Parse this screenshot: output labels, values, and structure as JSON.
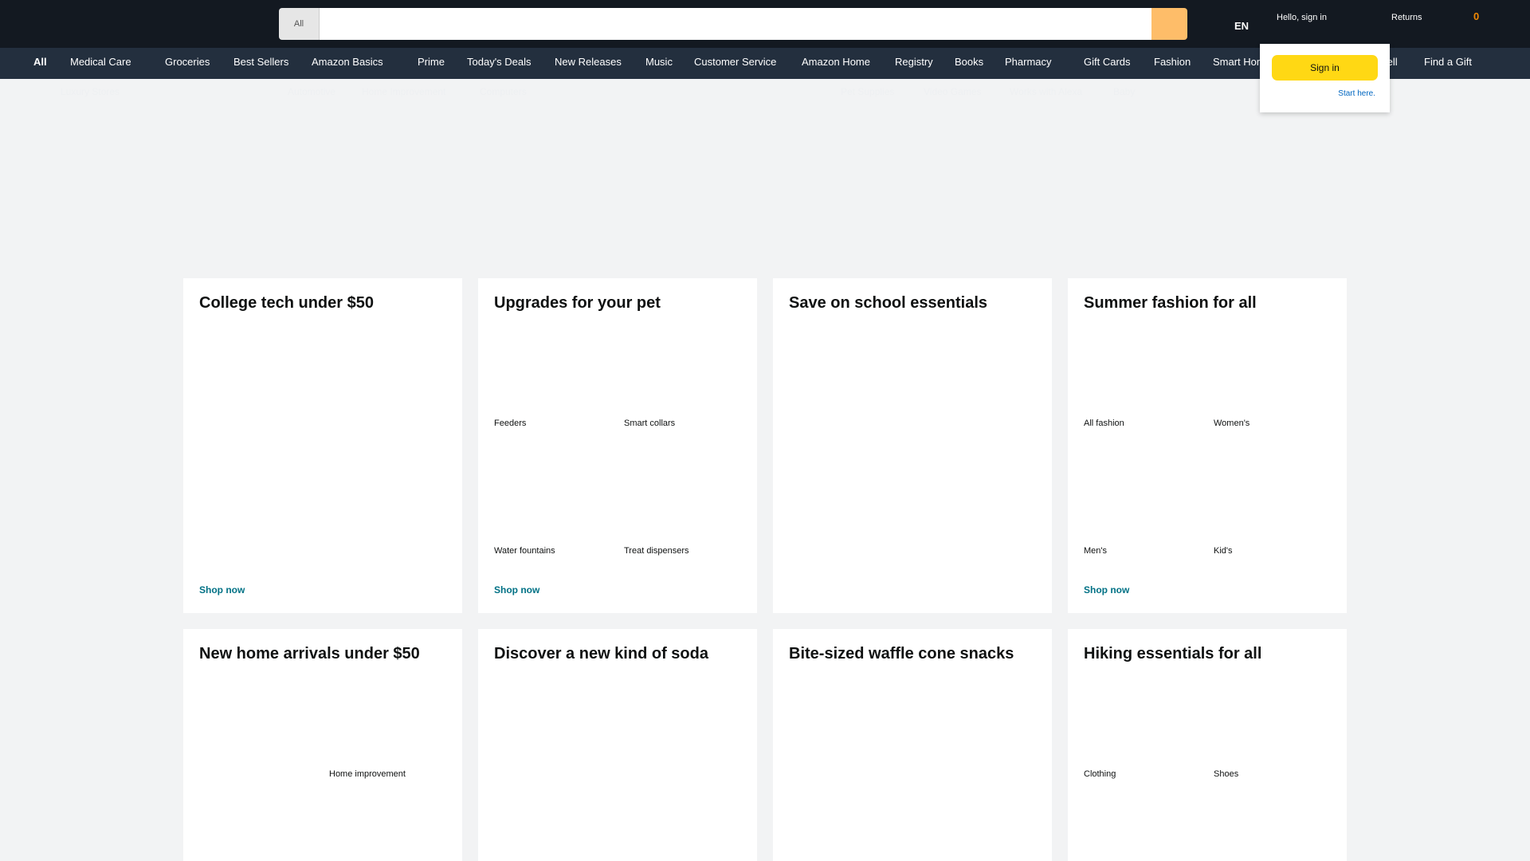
{
  "header": {
    "search_category": "All",
    "search_placeholder": "",
    "language": "EN",
    "hello": "Hello, sign in",
    "returns": "Returns",
    "cart_count": "0"
  },
  "nav": {
    "items": [
      "All",
      "Medical Care",
      "Groceries",
      "Best Sellers",
      "Amazon Basics",
      "Prime",
      "Today's Deals",
      "New Releases",
      "Music",
      "Customer Service",
      "Amazon Home",
      "Registry",
      "Books",
      "Pharmacy",
      "Gift Cards",
      "Fashion",
      "Smart Home",
      "Sell",
      "Find a Gift"
    ],
    "sub_items": [
      "Luxury Stores",
      "Automotive",
      "Home Improvement",
      "Computers",
      "Pet Supplies",
      "Video Games",
      "Works with Alexa",
      "Baby"
    ]
  },
  "flyout": {
    "sign_in": "Sign in",
    "start_here": "Start here."
  },
  "cards": [
    {
      "title": "College tech under $50",
      "labels": [],
      "link": "Shop now"
    },
    {
      "title": "Upgrades for your pet",
      "labels": [
        "Feeders",
        "Smart collars",
        "Water fountains",
        "Treat dispensers"
      ],
      "link": "Shop now"
    },
    {
      "title": "Save on school essentials",
      "labels": [],
      "link": ""
    },
    {
      "title": "Summer fashion for all",
      "labels": [
        "All fashion",
        "Women's",
        "Men's",
        "Kid's"
      ],
      "link": "Shop now"
    },
    {
      "title": "New home arrivals under $50",
      "labels": [
        "Home improvement"
      ],
      "link": ""
    },
    {
      "title": "Discover a new kind of soda",
      "labels": [],
      "link": ""
    },
    {
      "title": "Bite-sized waffle cone snacks",
      "labels": [],
      "link": ""
    },
    {
      "title": "Hiking essentials for all",
      "labels": [
        "Clothing",
        "Shoes"
      ],
      "link": ""
    }
  ]
}
